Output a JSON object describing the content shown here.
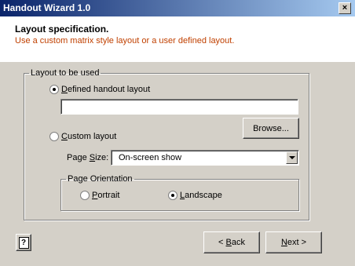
{
  "window": {
    "title": "Handout Wizard 1.0",
    "close_glyph": "×"
  },
  "header": {
    "heading": "Layout specification.",
    "subheading": "Use a custom matrix style layout or a user defined layout."
  },
  "layout_group": {
    "legend": "Layout to be used",
    "defined": {
      "label_first": "D",
      "label_rest": "efined handout layout",
      "checked": true,
      "path_value": ""
    },
    "browse_label": "Browse...",
    "custom": {
      "label_first": "C",
      "label_rest": "ustom layout",
      "checked": false
    },
    "page_size": {
      "label_pre": "Page ",
      "label_u": "S",
      "label_post": "ize:",
      "value": "On-screen show"
    },
    "orientation": {
      "legend": "Page Orientation",
      "portrait": {
        "label_first": "P",
        "label_rest": "ortrait",
        "checked": false
      },
      "landscape": {
        "label_first": "L",
        "label_rest": "andscape",
        "checked": true
      }
    }
  },
  "footer": {
    "help_glyph": "?",
    "back": {
      "pre": "< ",
      "u": "B",
      "post": "ack"
    },
    "next": {
      "pre": "",
      "u": "N",
      "post": "ext >"
    }
  }
}
